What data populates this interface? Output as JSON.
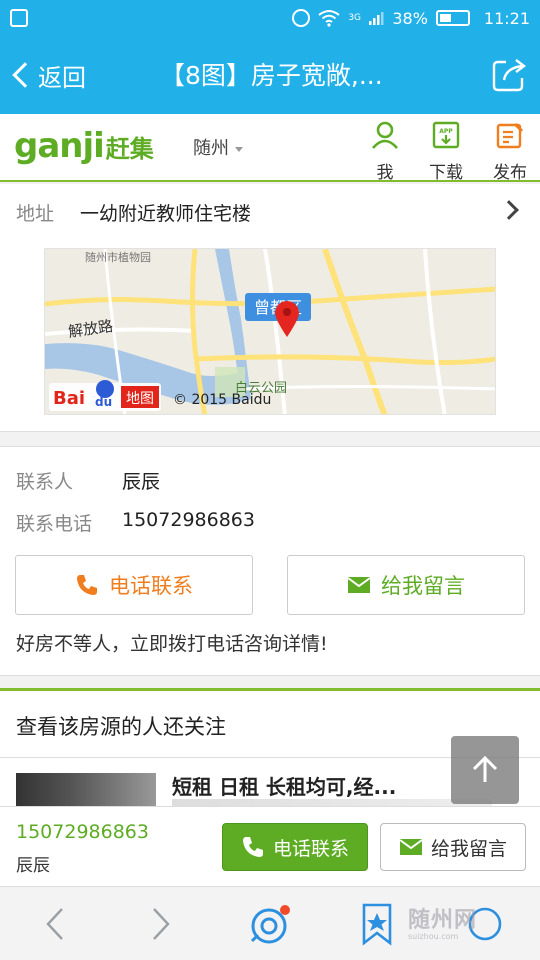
{
  "status_bar": {
    "battery": "38%",
    "time": "11:21",
    "network": "3G"
  },
  "header": {
    "back_label": "返回",
    "title": "【8图】房子宽敞,..."
  },
  "brand": {
    "logo_en": "ganji",
    "logo_cn": "赶集",
    "city": "随州",
    "nav": [
      {
        "label": "我",
        "icon": "user-icon"
      },
      {
        "label": "下载",
        "icon": "app-download-icon"
      },
      {
        "label": "发布",
        "icon": "publish-icon"
      }
    ]
  },
  "address": {
    "key": "地址",
    "value": "一幼附近教师住宅楼"
  },
  "map": {
    "district_label": "曾都区",
    "road_label": "解放路",
    "park_label": "白云公园",
    "top_label": "随州市植物园",
    "logo_text": "Bai",
    "logo_du": "du",
    "logo_cn": "地图",
    "copyright": "© 2015 Baidu"
  },
  "contact": {
    "person_key": "联系人",
    "person_value": "辰辰",
    "phone_key": "联系电话",
    "phone_value": "15072986863",
    "call_button": "电话联系",
    "message_button": "给我留言",
    "hint": "好房不等人，立即拨打电话咨询详情!"
  },
  "related": {
    "title": "查看该房源的人还关注",
    "items": [
      {
        "title": "短租 日租 长租均可,经..."
      }
    ]
  },
  "bottom_bar": {
    "phone": "15072986863",
    "name": "辰辰",
    "call_button": "电话联系",
    "message_button": "给我留言"
  },
  "watermark": {
    "text": "随州网",
    "sub": "suizhou.com"
  },
  "colors": {
    "header_blue": "#22b0e8",
    "brand_green": "#5eac24",
    "call_orange": "#f07d1e"
  }
}
